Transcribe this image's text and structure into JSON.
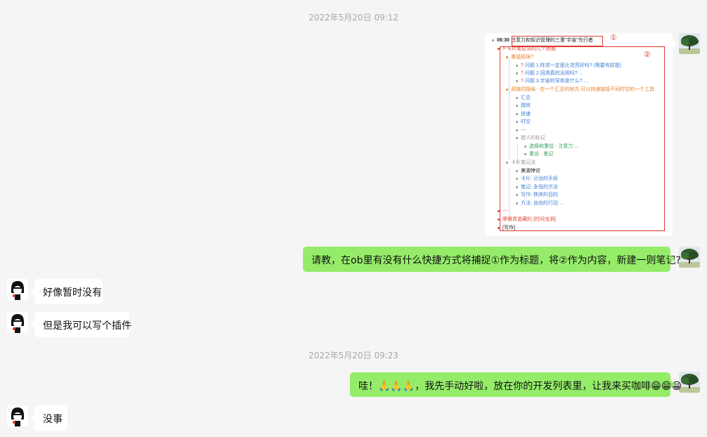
{
  "timestamps": [
    "2022年5月20日 09:12",
    "2022年5月20日 09:23"
  ],
  "messages": {
    "question": "请教，在ob里有没有什么快捷方式将捕捉①作为标题，将②作为内容，新建一则笔记?",
    "reply1": "好像暂时没有",
    "reply2": "但是我可以写个插件",
    "thanks": "哇！🙏🙏🙏，我先手动好啦，放在你的开发列表里，让我来买咖啡😁😁😁",
    "reply3": "没事"
  },
  "screenshot": {
    "marker1": "①",
    "marker2": "②",
    "lines": [
      {
        "time": "06:30",
        "text": "注意力和知识管理的三重\"宇宙\"先行者"
      },
      {
        "text": "卡片笔记法的几个困惑"
      },
      {
        "text": "重组困境?"
      },
      {
        "text": "问题 1.阵述一定是比流亮好吗? (需要有前提)"
      },
      {
        "text": "问题 2.回溯真的没用吗? ..."
      },
      {
        "text": "问题 3.宇宙的导体是什么? ..."
      },
      {
        "text": "双链的隐喻 - 在一个汇总的地方,可以快速链接不同时空的一个工具"
      },
      {
        "text": "汇总"
      },
      {
        "text": "跳转"
      },
      {
        "text": "快速"
      },
      {
        "text": "时空"
      },
      {
        "text": "---"
      },
      {
        "text": "猎人的标记"
      },
      {
        "text": "选择和重估 - 注意力 ..."
      },
      {
        "text": "重访 - 笔记"
      },
      {
        "text": "卡片笔记法"
      },
      {
        "text": "美湖悖论"
      },
      {
        "text": "卡片: 分治的手段"
      },
      {
        "text": "笔记: 永恒的方法"
      },
      {
        "text": "写作: 秩序的目的"
      },
      {
        "text": "方法: 自由的行动 ..."
      },
      {
        "text": "---"
      },
      {
        "text": "摩根青苗藏的 [时间虫洞]"
      },
      {
        "text": "[写作]"
      }
    ]
  }
}
